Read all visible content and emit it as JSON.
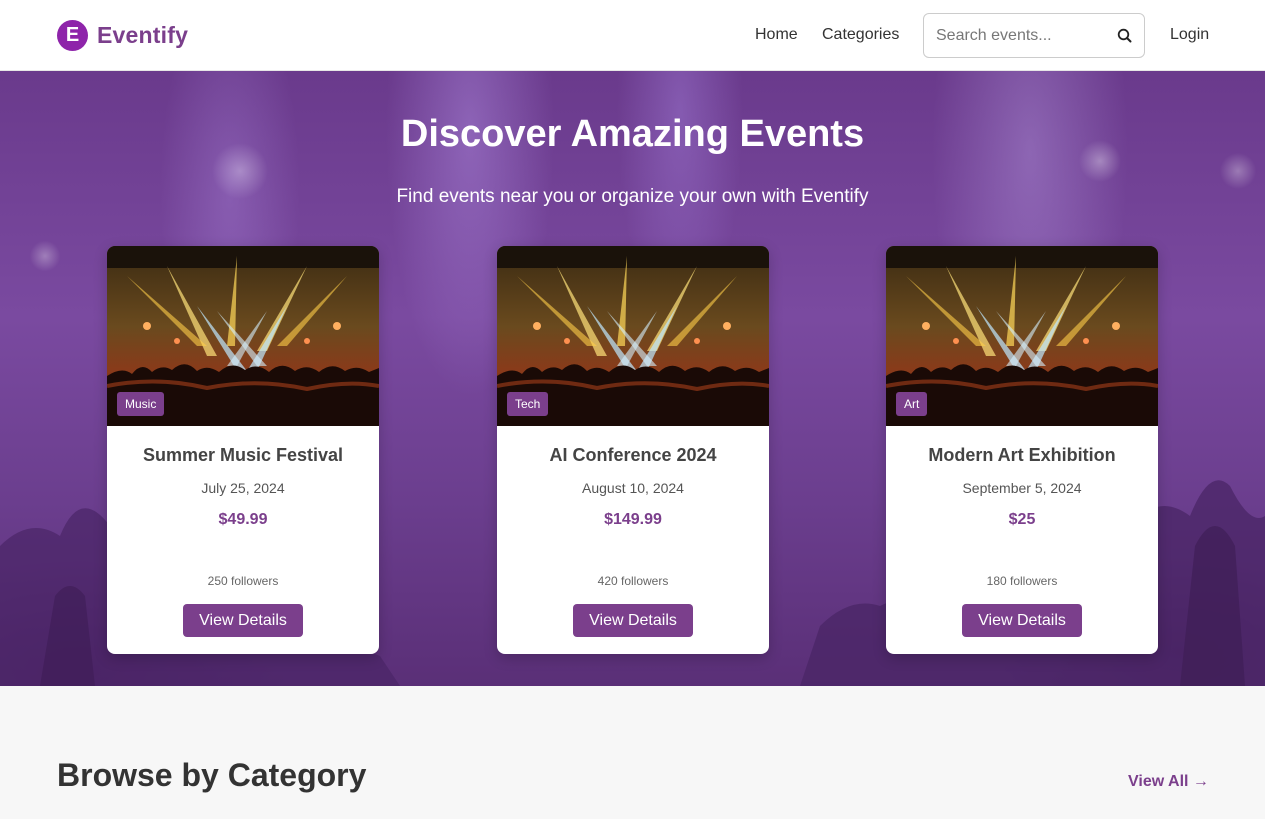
{
  "brand": {
    "logo_letter": "E",
    "name": "Eventify",
    "color": "#7b3f8c",
    "logo_color": "#8e24aa"
  },
  "nav": {
    "home": "Home",
    "categories": "Categories",
    "search_placeholder": "Search events...",
    "search_icon": "search-icon",
    "login": "Login"
  },
  "hero": {
    "title": "Discover Amazing Events",
    "subtitle": "Find events near you or organize your own with Eventify"
  },
  "events": [
    {
      "category": "Music",
      "title": "Summer Music Festival",
      "date": "July 25, 2024",
      "price": "$49.99",
      "followers": "250 followers",
      "button": "View Details"
    },
    {
      "category": "Tech",
      "title": "AI Conference 2024",
      "date": "August 10, 2024",
      "price": "$149.99",
      "followers": "420 followers",
      "button": "View Details"
    },
    {
      "category": "Art",
      "title": "Modern Art Exhibition",
      "date": "September 5, 2024",
      "price": "$25",
      "followers": "180 followers",
      "button": "View Details"
    }
  ],
  "categories_section": {
    "title": "Browse by Category",
    "view_all": "View All →"
  }
}
